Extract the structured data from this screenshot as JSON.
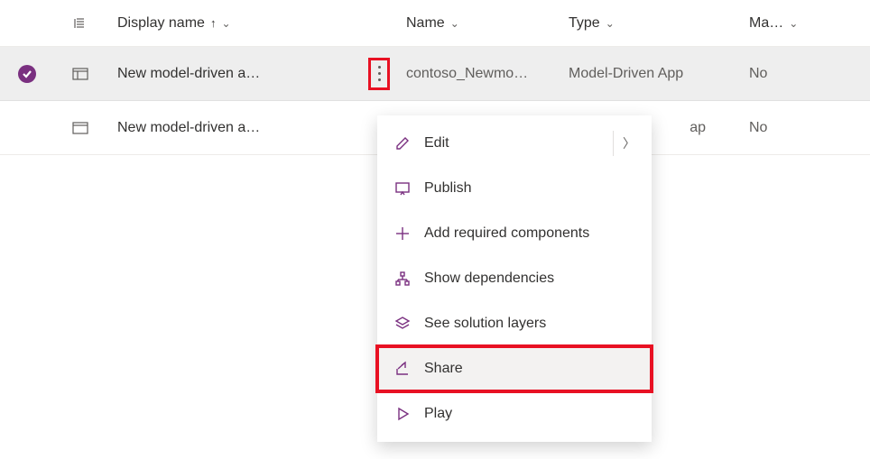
{
  "columns": {
    "display": "Display name",
    "name": "Name",
    "type": "Type",
    "managed": "Ma…"
  },
  "rows": [
    {
      "display": "New model-driven a…",
      "name": "contoso_Newmo…",
      "type": "Model-Driven App",
      "managed": "No",
      "selected": true
    },
    {
      "display": "New model-driven a…",
      "name": "",
      "type": "ap",
      "managed": "No",
      "selected": false
    }
  ],
  "menu": {
    "edit": "Edit",
    "publish": "Publish",
    "add": "Add required components",
    "deps": "Show dependencies",
    "layers": "See solution layers",
    "share": "Share",
    "play": "Play"
  }
}
